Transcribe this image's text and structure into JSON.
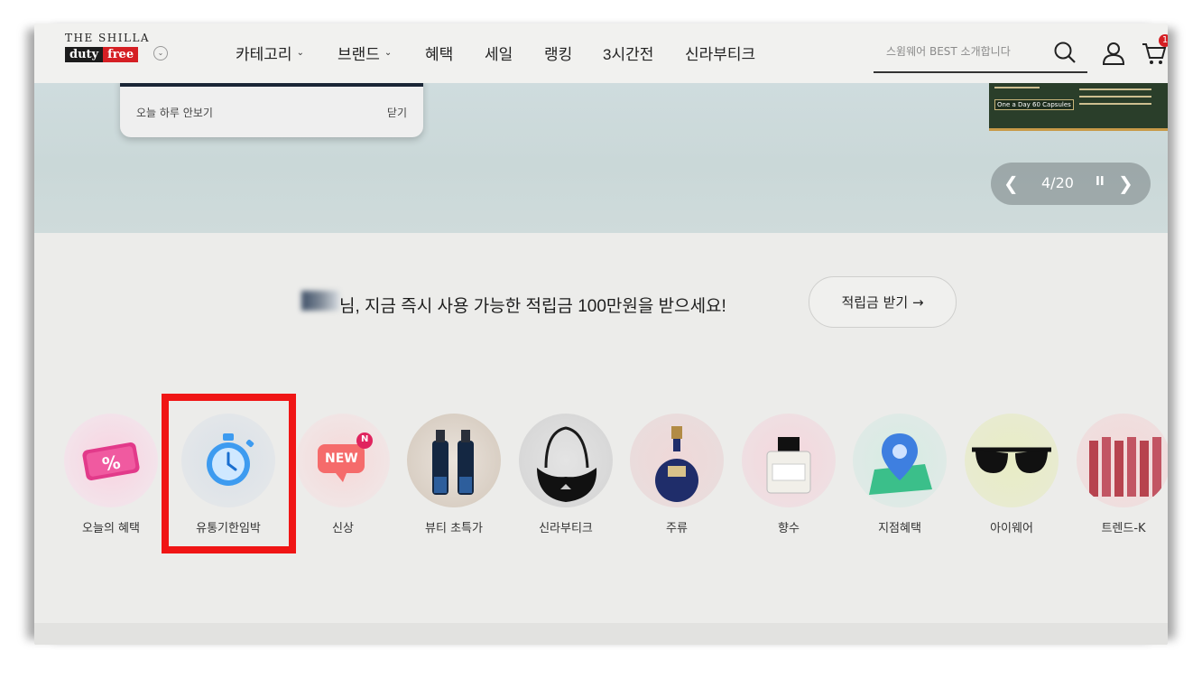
{
  "header": {
    "logo_top": "THE SHILLA",
    "logo_duty": "duty",
    "logo_free": "free",
    "nav": [
      {
        "label": "카테고리",
        "dropdown": true
      },
      {
        "label": "브랜드",
        "dropdown": true
      },
      {
        "label": "혜택",
        "dropdown": false
      },
      {
        "label": "세일",
        "dropdown": false
      },
      {
        "label": "랭킹",
        "dropdown": false
      },
      {
        "label": "3시간전",
        "dropdown": false
      },
      {
        "label": "신라부티크",
        "dropdown": false
      }
    ],
    "search_placeholder": "스윔웨어 BEST 소개합니다",
    "cart_count": "1"
  },
  "popup": {
    "dismiss_today": "오늘 하루 안보기",
    "close": "닫기"
  },
  "banner": {
    "product_badge": "One a Day 60 Capsules",
    "pager_current": "4",
    "pager_total": "20",
    "pager_text": "4/20"
  },
  "points": {
    "message": "님, 지금 즉시 사용 가능한 적립금 100만원을 받으세요!",
    "button": "적립금 받기 →"
  },
  "categories": [
    {
      "label": "오늘의 혜택",
      "icon": "coupon-icon"
    },
    {
      "label": "유통기한임박",
      "icon": "stopwatch-icon"
    },
    {
      "label": "신상",
      "icon": "new-badge-icon"
    },
    {
      "label": "뷰티 초특가",
      "icon": "serum-bottles-image"
    },
    {
      "label": "신라부티크",
      "icon": "handbag-image"
    },
    {
      "label": "주류",
      "icon": "liquor-bottle-image"
    },
    {
      "label": "향수",
      "icon": "perfume-image"
    },
    {
      "label": "지점혜택",
      "icon": "map-pin-icon"
    },
    {
      "label": "아이웨어",
      "icon": "sunglasses-image"
    },
    {
      "label": "트렌드-K",
      "icon": "lipstick-image"
    }
  ],
  "new_badge_letter": "N",
  "new_badge_text": "NEW",
  "colors": {
    "brand_red": "#d51f24",
    "highlight_red": "#f01515",
    "clock_blue": "#3d9bf0"
  }
}
